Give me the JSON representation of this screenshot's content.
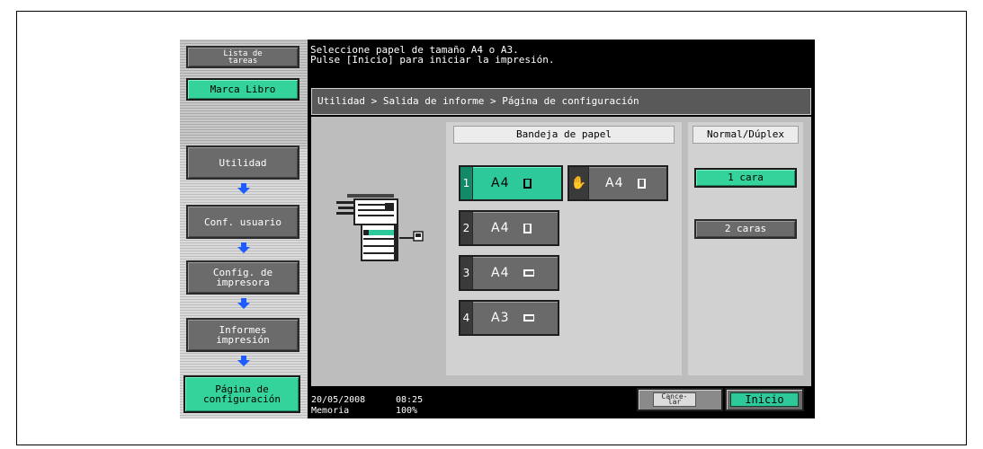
{
  "left_nav": {
    "task_list_label": "Lista de\ntareas",
    "bookmark_label": "Marca Libro",
    "steps": [
      {
        "label": "Utilidad",
        "state": "inactive"
      },
      {
        "label": "Conf. usuario",
        "state": "inactive"
      },
      {
        "label": "Config. de\nimpresora",
        "state": "inactive"
      },
      {
        "label": "Informes\nimpresión",
        "state": "inactive"
      },
      {
        "label": "Página de\nconfiguración",
        "state": "active"
      }
    ]
  },
  "message": {
    "text": "Seleccione papel de tamaño A4 o A3.\nPulse [Inicio] para iniciar la impresión."
  },
  "breadcrumb": {
    "text": "Utilidad > Salida de informe > Página de configuración"
  },
  "paper_tray": {
    "header": "Bandeja de papel",
    "trays": [
      {
        "number": "1",
        "size": "A4",
        "orientation": "portrait",
        "selected": true
      },
      {
        "number": "✋",
        "size": "A4",
        "orientation": "portrait",
        "selected": false,
        "kind": "bypass"
      },
      {
        "number": "2",
        "size": "A4",
        "orientation": "portrait",
        "selected": false
      },
      {
        "number": "3",
        "size": "A4",
        "orientation": "landscape",
        "selected": false
      },
      {
        "number": "4",
        "size": "A3",
        "orientation": "landscape",
        "selected": false
      }
    ]
  },
  "duplex": {
    "header": "Normal/Dúplex",
    "options": [
      {
        "label": "1 cara",
        "selected": true
      },
      {
        "label": "2 caras",
        "selected": false
      }
    ]
  },
  "footer": {
    "date": "20/05/2008",
    "time": "08:25",
    "memory_label": "Memoria",
    "memory_value": "100%",
    "cancel_label": "Cance-\nlar",
    "start_label": "Inicio"
  },
  "colors": {
    "accent_green": "#2ec99a",
    "button_gray": "#6a6a6a",
    "arrow_blue": "#1e5cff"
  }
}
